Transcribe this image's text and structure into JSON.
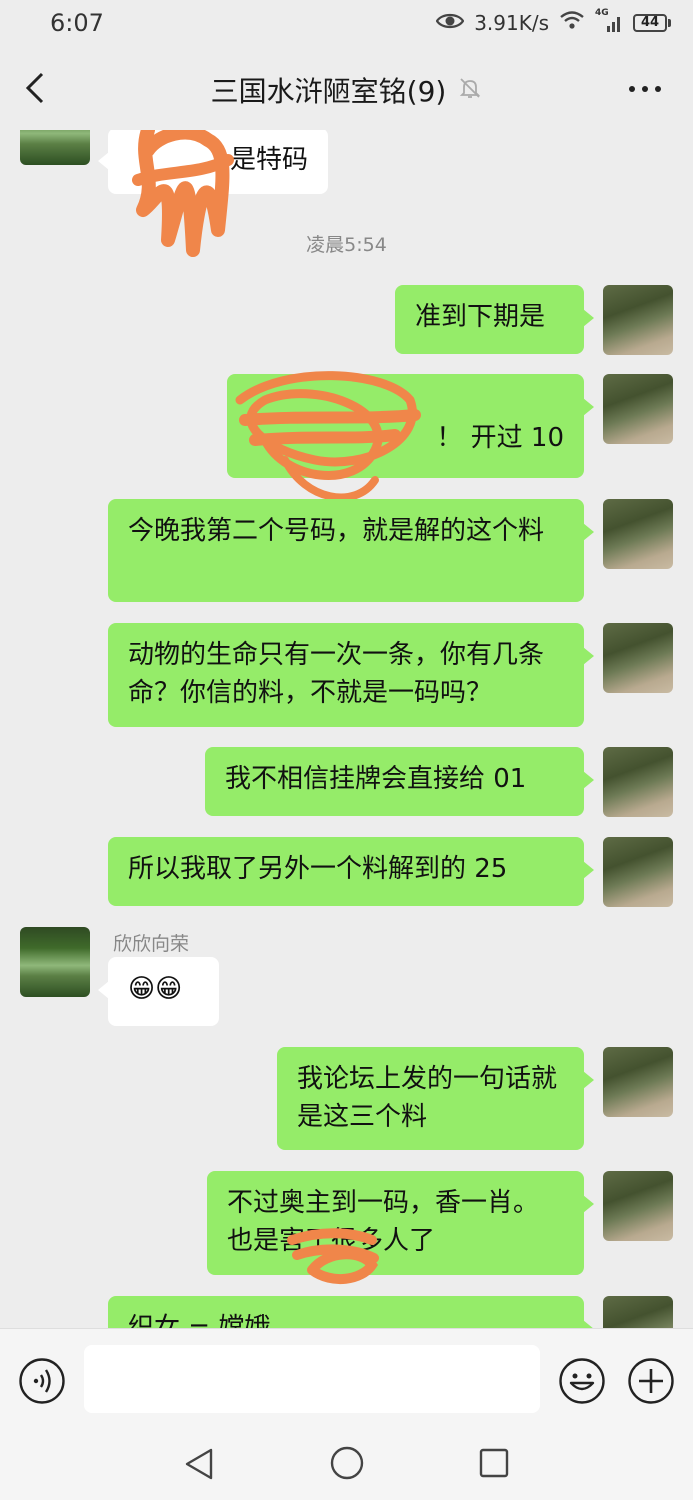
{
  "status_bar": {
    "time": "6:07",
    "network_speed": "3.91K/s",
    "signal_label": "4G",
    "battery": "44"
  },
  "header": {
    "title": "三国水浒陋室铭(9)"
  },
  "messages": [
    {
      "side": "other",
      "text": "是特码"
    },
    {
      "type": "time",
      "text": "凌晨5:54"
    },
    {
      "side": "me",
      "text": "准到下期是"
    },
    {
      "side": "me",
      "line1": "",
      "line2": "！ 开过 10"
    },
    {
      "side": "me",
      "text": "今晚我第二个号码，就是解的这个料"
    },
    {
      "side": "me",
      "text": "动物的生命只有一次一条，你有几条命？你信的料，不就是一码吗？"
    },
    {
      "side": "me",
      "text": "我不相信挂牌会直接给 01"
    },
    {
      "side": "me",
      "text": "所以我取了另外一个料解到的 25"
    },
    {
      "side": "other",
      "sender": "欣欣向荣",
      "text": "😁😁"
    },
    {
      "side": "me",
      "text": "我论坛上发的一句话就是这三个料"
    },
    {
      "side": "me",
      "text": "不过奥主到一码，香一肖。也是害了很多人了"
    },
    {
      "side": "me",
      "text": "织女 = 嫦娥"
    }
  ],
  "input": {
    "placeholder": ""
  },
  "colors": {
    "background": "#ededed",
    "my_bubble": "#95ec69",
    "other_bubble": "#ffffff",
    "scribble": "#f0864a"
  }
}
